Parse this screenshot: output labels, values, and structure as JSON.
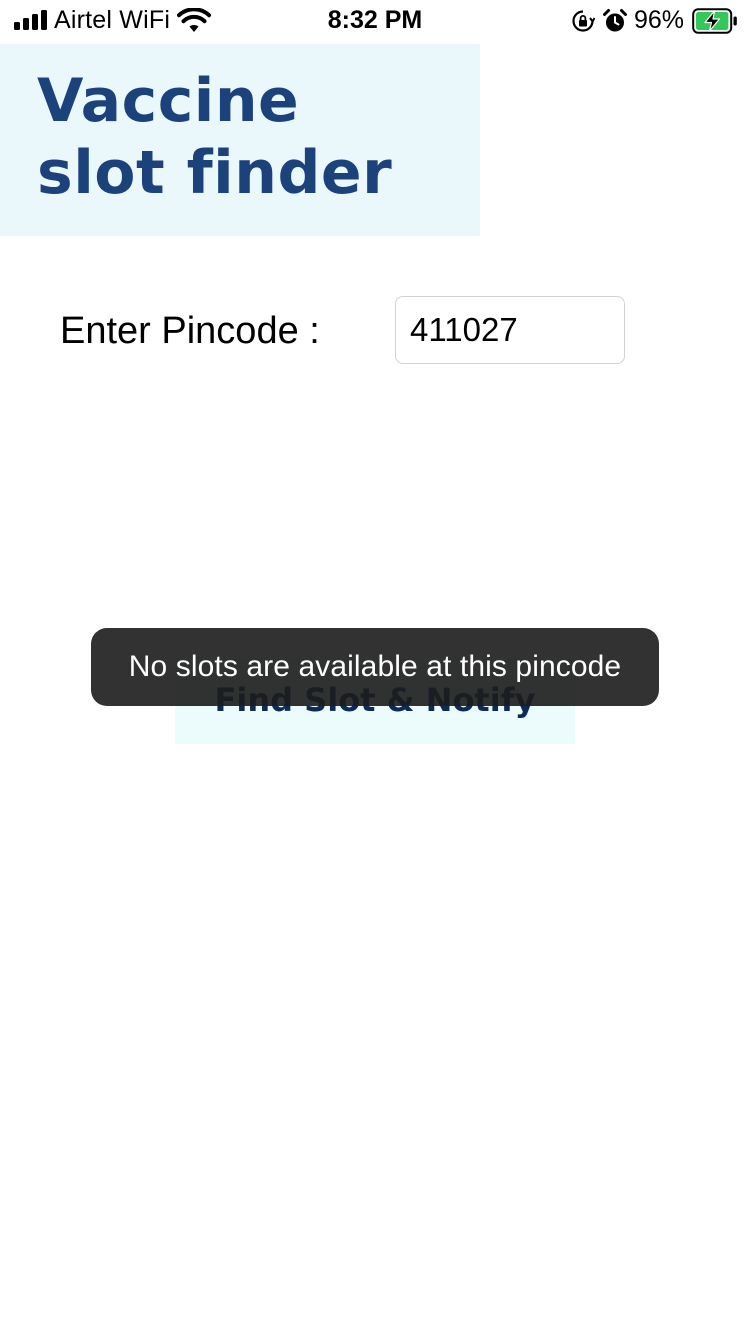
{
  "status_bar": {
    "carrier": "Airtel WiFi",
    "time": "8:32 PM",
    "battery_percent": "96%",
    "battery_level": 0.96,
    "icons": [
      "signal-icon",
      "wifi-icon",
      "orientation-lock-icon",
      "alarm-icon",
      "battery-charging-icon"
    ],
    "battery_color": "#34c759"
  },
  "banner": {
    "line1": "Vaccine",
    "line2": "slot finder",
    "text_color": "#1c427c",
    "background": "#eaf8fb"
  },
  "pincode": {
    "label": "Enter Pincode :",
    "value": "411027"
  },
  "actions": {
    "find_label": "Find Slot & Notify"
  },
  "toast": {
    "message": "No slots are available at this pincode"
  }
}
